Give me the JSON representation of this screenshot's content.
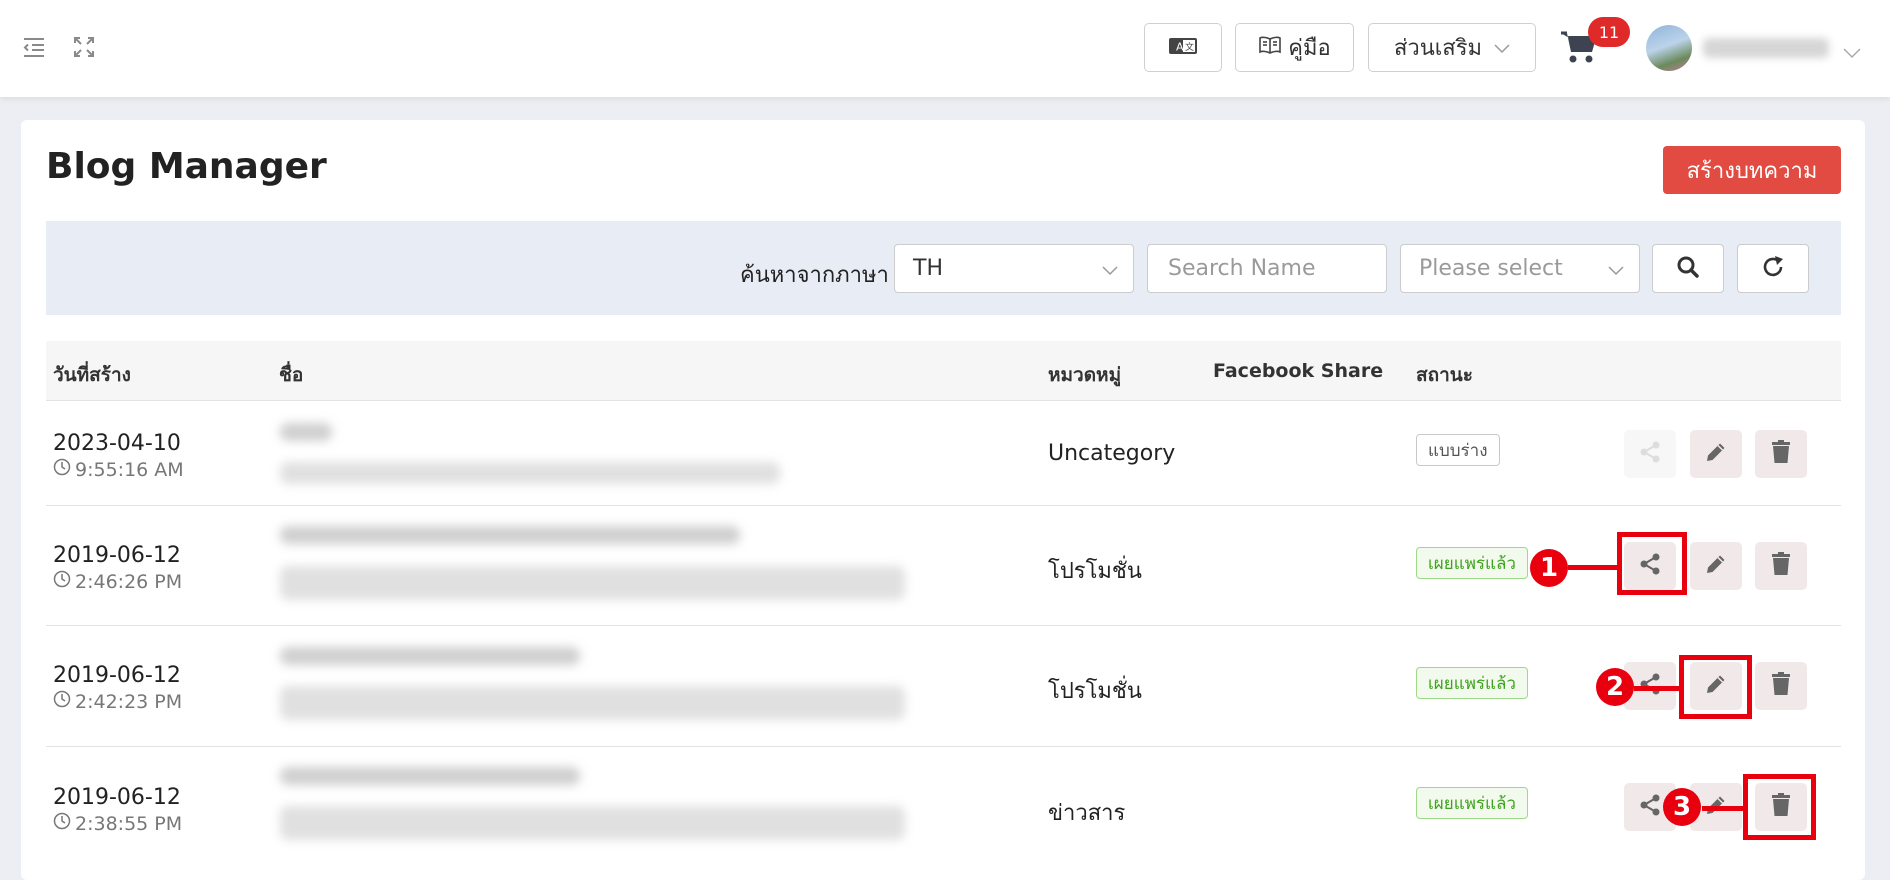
{
  "header": {
    "manual_label": "คู่มือ",
    "addons_label": "ส่วนเสริม",
    "cart_count": "11"
  },
  "page": {
    "title": "Blog Manager",
    "create_label": "สร้างบทความ"
  },
  "filters": {
    "language_label": "ค้นหาจากภาษา",
    "language_value": "TH",
    "search_placeholder": "Search Name",
    "select_placeholder": "Please select"
  },
  "table": {
    "columns": {
      "created": "วันที่สร้าง",
      "name": "ชื่อ",
      "category": "หมวดหมู่",
      "facebook": "Facebook Share",
      "status": "สถานะ"
    },
    "rows": [
      {
        "date": "2023-04-10",
        "time": "9:55:16 AM",
        "category": "Uncategory",
        "status": "แบบร่าง",
        "status_type": "draft"
      },
      {
        "date": "2019-06-12",
        "time": "2:46:26 PM",
        "category": "โปรโมชั่น",
        "status": "เผยแพร่แล้ว",
        "status_type": "published"
      },
      {
        "date": "2019-06-12",
        "time": "2:42:23 PM",
        "category": "โปรโมชั่น",
        "status": "เผยแพร่แล้ว",
        "status_type": "published"
      },
      {
        "date": "2019-06-12",
        "time": "2:38:55 PM",
        "category": "ข่าวสาร",
        "status": "เผยแพร่แล้ว",
        "status_type": "published"
      }
    ]
  },
  "annotations": [
    "1",
    "2",
    "3"
  ],
  "colors": {
    "primary_red": "#e24b41",
    "highlight_red": "#e8000e",
    "published_green": "#3ea31e",
    "filter_bg": "#e8ecf5"
  }
}
